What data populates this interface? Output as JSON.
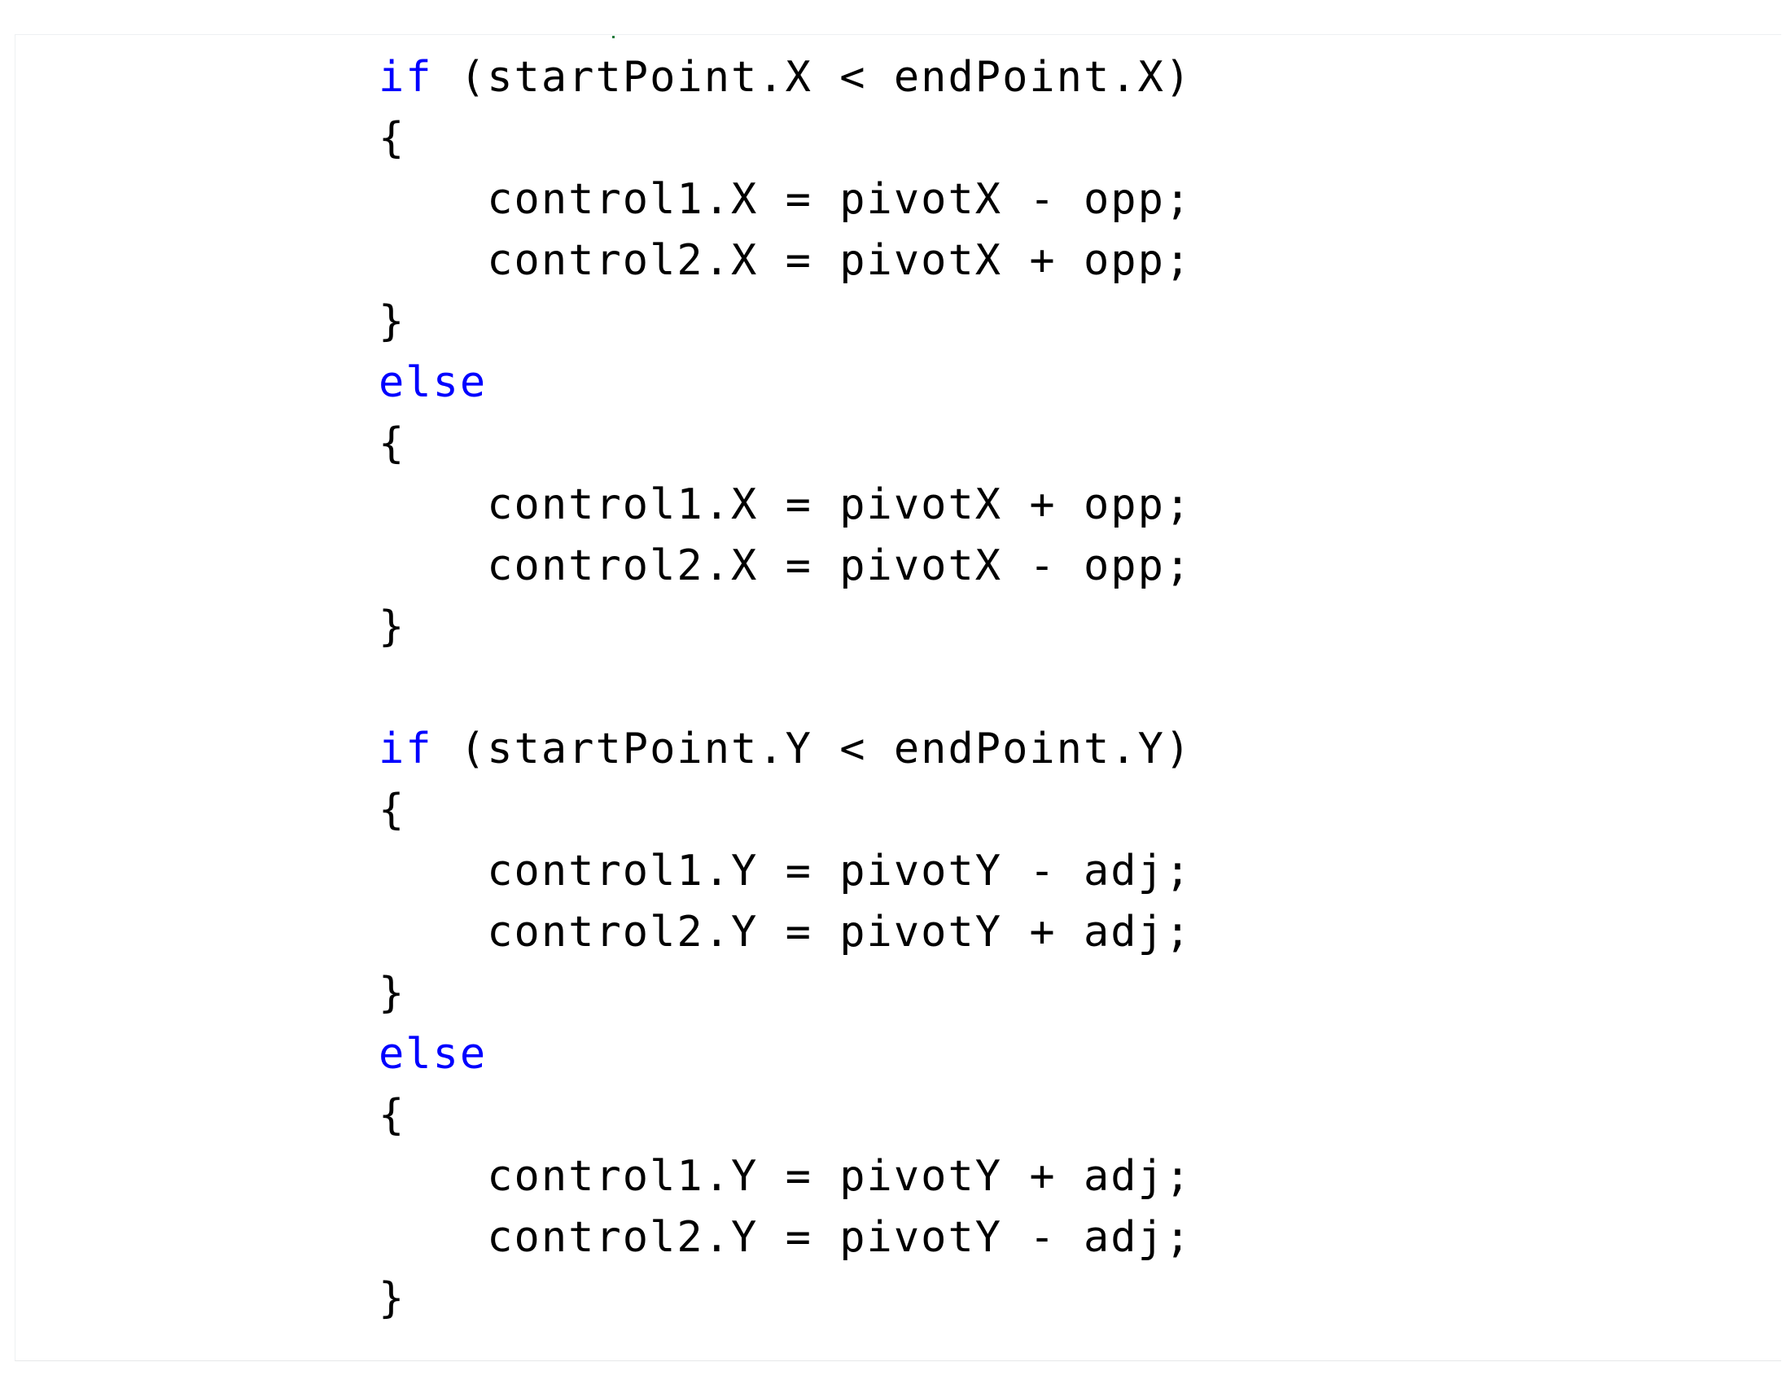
{
  "colors": {
    "keyword": "#0000ff",
    "text": "#000000",
    "background": "#ffffff"
  },
  "code": {
    "lines": [
      {
        "indent": "",
        "keyword": "if",
        "text": " (startPoint.X < endPoint.X)"
      },
      {
        "indent": "",
        "keyword": "",
        "text": "{"
      },
      {
        "indent": "    ",
        "keyword": "",
        "text": "control1.X = pivotX - opp;"
      },
      {
        "indent": "    ",
        "keyword": "",
        "text": "control2.X = pivotX + opp;"
      },
      {
        "indent": "",
        "keyword": "",
        "text": "}"
      },
      {
        "indent": "",
        "keyword": "else",
        "text": ""
      },
      {
        "indent": "",
        "keyword": "",
        "text": "{"
      },
      {
        "indent": "    ",
        "keyword": "",
        "text": "control1.X = pivotX + opp;"
      },
      {
        "indent": "    ",
        "keyword": "",
        "text": "control2.X = pivotX - opp;"
      },
      {
        "indent": "",
        "keyword": "",
        "text": "}"
      },
      {
        "indent": "",
        "keyword": "",
        "text": ""
      },
      {
        "indent": "",
        "keyword": "if",
        "text": " (startPoint.Y < endPoint.Y)"
      },
      {
        "indent": "",
        "keyword": "",
        "text": "{"
      },
      {
        "indent": "    ",
        "keyword": "",
        "text": "control1.Y = pivotY - adj;"
      },
      {
        "indent": "    ",
        "keyword": "",
        "text": "control2.Y = pivotY + adj;"
      },
      {
        "indent": "",
        "keyword": "",
        "text": "}"
      },
      {
        "indent": "",
        "keyword": "else",
        "text": ""
      },
      {
        "indent": "",
        "keyword": "",
        "text": "{"
      },
      {
        "indent": "    ",
        "keyword": "",
        "text": "control1.Y = pivotY + adj;"
      },
      {
        "indent": "    ",
        "keyword": "",
        "text": "control2.Y = pivotY - adj;"
      },
      {
        "indent": "",
        "keyword": "",
        "text": "}"
      }
    ]
  }
}
